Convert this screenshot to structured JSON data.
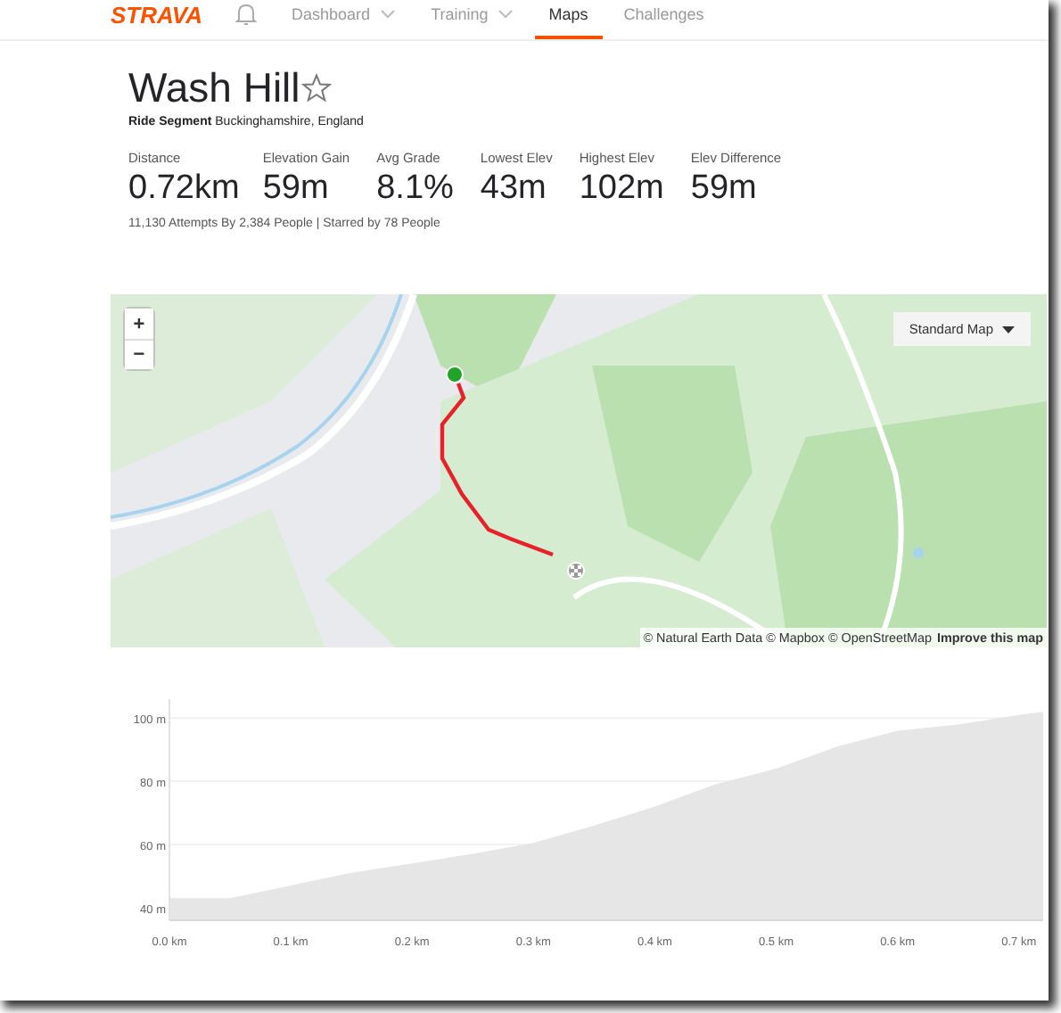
{
  "nav": {
    "logo": "STRAVA",
    "items": [
      {
        "label": "Dashboard",
        "selected": false,
        "dropdown": true
      },
      {
        "label": "Training",
        "selected": false,
        "dropdown": true
      },
      {
        "label": "Maps",
        "selected": true,
        "dropdown": false
      },
      {
        "label": "Challenges",
        "selected": false,
        "dropdown": false
      }
    ]
  },
  "segment": {
    "title": "Wash Hill",
    "starred": false,
    "type": "Ride Segment",
    "location": "Buckinghamshire, England"
  },
  "stats": [
    {
      "label": "Distance",
      "value": "0.72km"
    },
    {
      "label": "Elevation Gain",
      "value": "59m"
    },
    {
      "label": "Avg Grade",
      "value": "8.1%"
    },
    {
      "label": "Lowest Elev",
      "value": "43m"
    },
    {
      "label": "Highest Elev",
      "value": "102m"
    },
    {
      "label": "Elev Difference",
      "value": "59m"
    }
  ],
  "summary": "11,130 Attempts By 2,384 People | Starred by 78 People",
  "map": {
    "zoom_in": "+",
    "zoom_out": "−",
    "style": "Standard Map",
    "attribution": "© Natural Earth Data © Mapbox © OpenStreetMap",
    "improve_link": "Improve this map"
  },
  "elevation_chart": {
    "chart_data": {
      "type": "area",
      "x": [
        0,
        0.05,
        0.1,
        0.15,
        0.2,
        0.25,
        0.3,
        0.35,
        0.4,
        0.45,
        0.5,
        0.55,
        0.6,
        0.65,
        0.7,
        0.72
      ],
      "grid": true,
      "series": [
        {
          "color": "#e6e6e6",
          "values": [
            43,
            43,
            47,
            51,
            54,
            57,
            60.5,
            66,
            72,
            79,
            84,
            91,
            96,
            98,
            101,
            102
          ]
        }
      ],
      "xlim": [
        0,
        0.72
      ],
      "ylim": [
        36,
        106
      ],
      "xticks": [
        {
          "value": 0,
          "label": "0.0 km"
        },
        {
          "value": 0.1,
          "label": "0.1 km"
        },
        {
          "value": 0.2,
          "label": "0.2 km"
        },
        {
          "value": 0.3,
          "label": "0.3 km"
        },
        {
          "value": 0.4,
          "label": "0.4 km"
        },
        {
          "value": 0.5,
          "label": "0.5 km"
        },
        {
          "value": 0.6,
          "label": "0.6 km"
        },
        {
          "value": 0.7,
          "label": "0.7 km"
        }
      ],
      "yticks": [
        {
          "value": 40,
          "label": "40 m"
        },
        {
          "value": 60,
          "label": "60 m"
        },
        {
          "value": 80,
          "label": "80 m"
        },
        {
          "value": 100,
          "label": "100 m"
        }
      ]
    }
  }
}
